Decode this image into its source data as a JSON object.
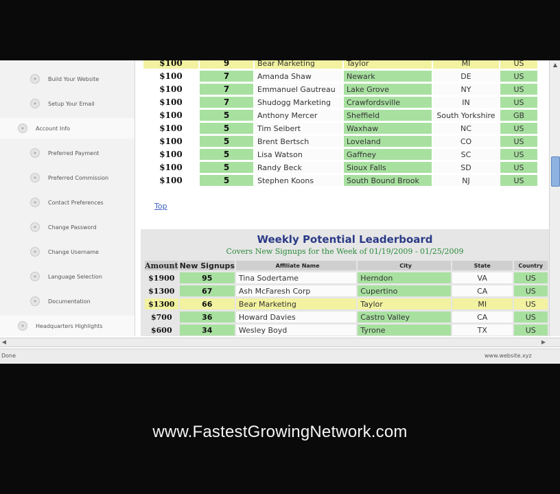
{
  "sidebar": {
    "items": [
      {
        "label": "Build Your Website",
        "level": "sub"
      },
      {
        "label": "Setup Your Email",
        "level": "sub"
      },
      {
        "label": "Account Info",
        "level": "top"
      },
      {
        "label": "Preferred Payment",
        "level": "sub"
      },
      {
        "label": "Preferred Commission",
        "level": "sub"
      },
      {
        "label": "Contact Preferences",
        "level": "sub"
      },
      {
        "label": "Change Password",
        "level": "sub"
      },
      {
        "label": "Change Username",
        "level": "sub"
      },
      {
        "label": "Language Selection",
        "level": "sub"
      },
      {
        "label": "Documentation",
        "level": "sub"
      },
      {
        "label": "Headquarters Highlights",
        "level": "top"
      }
    ]
  },
  "table1": {
    "rows": [
      {
        "amount": "$100",
        "count": "9",
        "name": "Bear Marketing",
        "city": "Taylor",
        "state": "MI",
        "country": "US",
        "highlight": true
      },
      {
        "amount": "$100",
        "count": "7",
        "name": "Amanda Shaw",
        "city": "Newark",
        "state": "DE",
        "country": "US"
      },
      {
        "amount": "$100",
        "count": "7",
        "name": "Emmanuel Gautreau",
        "city": "Lake Grove",
        "state": "NY",
        "country": "US"
      },
      {
        "amount": "$100",
        "count": "7",
        "name": "Shudogg Marketing",
        "city": "Crawfordsville",
        "state": "IN",
        "country": "US"
      },
      {
        "amount": "$100",
        "count": "5",
        "name": "Anthony Mercer",
        "city": "Sheffield",
        "state": "South Yorkshire",
        "country": "GB"
      },
      {
        "amount": "$100",
        "count": "5",
        "name": "Tim Seibert",
        "city": "Waxhaw",
        "state": "NC",
        "country": "US"
      },
      {
        "amount": "$100",
        "count": "5",
        "name": "Brent Bertsch",
        "city": "Loveland",
        "state": "CO",
        "country": "US"
      },
      {
        "amount": "$100",
        "count": "5",
        "name": "Lisa Watson",
        "city": "Gaffney",
        "state": "SC",
        "country": "US"
      },
      {
        "amount": "$100",
        "count": "5",
        "name": "Randy Beck",
        "city": "Sioux Falls",
        "state": "SD",
        "country": "US"
      },
      {
        "amount": "$100",
        "count": "5",
        "name": "Stephen Koons",
        "city": "South Bound Brook",
        "state": "NJ",
        "country": "US"
      }
    ]
  },
  "top_link": "Top",
  "leaderboard": {
    "title": "Weekly Potential Leaderboard",
    "subtitle": "Covers New Signups for the Week of 01/19/2009 - 01/25/2009",
    "headers": [
      "Amount",
      "New Signups",
      "Affiliate Name",
      "City",
      "State",
      "Country"
    ],
    "rows": [
      {
        "amount": "$1900",
        "count": "95",
        "name": "Tina Sodertame",
        "city": "Herndon",
        "state": "VA",
        "country": "US"
      },
      {
        "amount": "$1300",
        "count": "67",
        "name": "Ash McFaresh Corp",
        "city": "Cupertino",
        "state": "CA",
        "country": "US"
      },
      {
        "amount": "$1300",
        "count": "66",
        "name": "Bear Marketing",
        "city": "Taylor",
        "state": "MI",
        "country": "US",
        "highlight": true
      },
      {
        "amount": "$700",
        "count": "36",
        "name": "Howard Davies",
        "city": "Castro Valley",
        "state": "CA",
        "country": "US"
      },
      {
        "amount": "$600",
        "count": "34",
        "name": "Wesley Boyd",
        "city": "Tyrone",
        "state": "TX",
        "country": "US"
      }
    ]
  },
  "statusbar": {
    "text": "Done",
    "url": "www.website.xyz"
  },
  "footer": {
    "url": "www.FastestGrowingNetwork.com"
  },
  "colors": {
    "cell_green": "#a8e0a0",
    "highlight_yellow": "#f2f2a0",
    "title_blue": "#2b3a87",
    "subtitle_green": "#2a8a3a"
  }
}
